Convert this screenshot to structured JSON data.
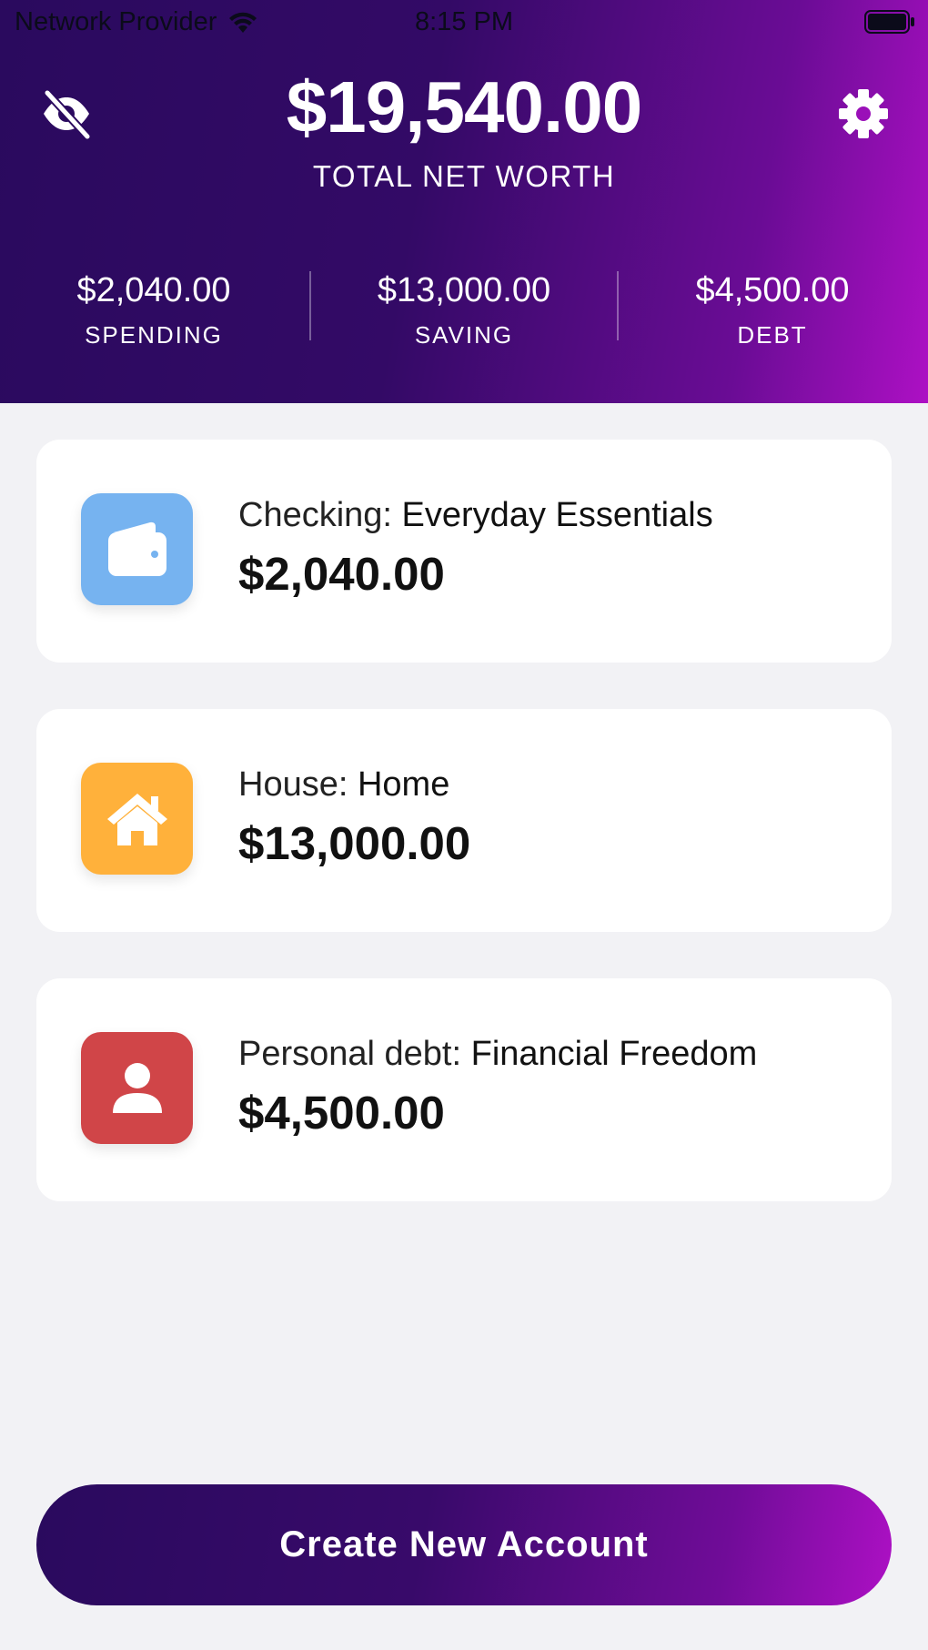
{
  "status_bar": {
    "carrier": "Network Provider",
    "time": "8:15 PM"
  },
  "header": {
    "net_worth": "$19,540.00",
    "net_worth_label": "TOTAL NET WORTH",
    "summary": [
      {
        "amount": "$2,040.00",
        "label": "SPENDING"
      },
      {
        "amount": "$13,000.00",
        "label": "SAVING"
      },
      {
        "amount": "$4,500.00",
        "label": "DEBT"
      }
    ]
  },
  "accounts": [
    {
      "type": "Checking: ",
      "name": "Everyday Essentials",
      "amount": "$2,040.00",
      "icon": "wallet-icon",
      "color": "#76b3f0"
    },
    {
      "type": "House: ",
      "name": "Home",
      "amount": "$13,000.00",
      "icon": "home-icon",
      "color": "#ffb13b"
    },
    {
      "type": "Personal debt: ",
      "name": "Financial Freedom",
      "amount": "$4,500.00",
      "icon": "person-icon",
      "color": "#d04548"
    }
  ],
  "create_button": {
    "label": "Create New Account"
  },
  "colors": {
    "gradient_start": "#2a0a5e",
    "gradient_end": "#ad10c4",
    "background": "#f2f2f5"
  }
}
